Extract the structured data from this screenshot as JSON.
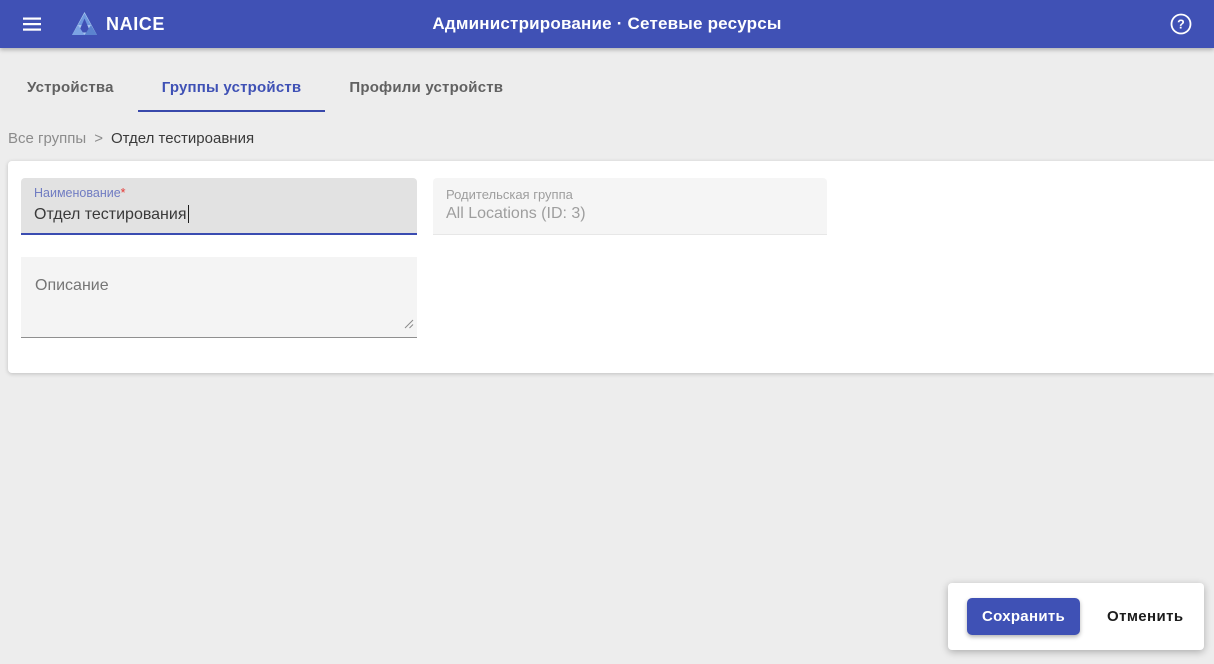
{
  "appbar": {
    "brand": "NAICE",
    "title": "Администрирование · Сетевые ресурсы"
  },
  "tabs": [
    {
      "label": "Устройства",
      "active": false
    },
    {
      "label": "Группы устройств",
      "active": true
    },
    {
      "label": "Профили устройств",
      "active": false
    }
  ],
  "breadcrumb": {
    "root": "Все группы",
    "separator": ">",
    "current": "Отдел тестироавния"
  },
  "form": {
    "name_field": {
      "label": "Наименование",
      "required_marker": "*",
      "value": "Отдел тестирования"
    },
    "parent_field": {
      "label": "Родительская группа",
      "value": "All Locations (ID: 3)",
      "state": "disabled"
    },
    "description_field": {
      "label": "Описание",
      "value": ""
    }
  },
  "actions": {
    "save_label": "Сохранить",
    "cancel_label": "Отменить"
  },
  "colors": {
    "accent": "#3f51b5",
    "appbar_bg": "#4051b5",
    "page_bg": "#ededed",
    "required_star": "#e53935",
    "focused_underline": "#3a4cb1"
  }
}
